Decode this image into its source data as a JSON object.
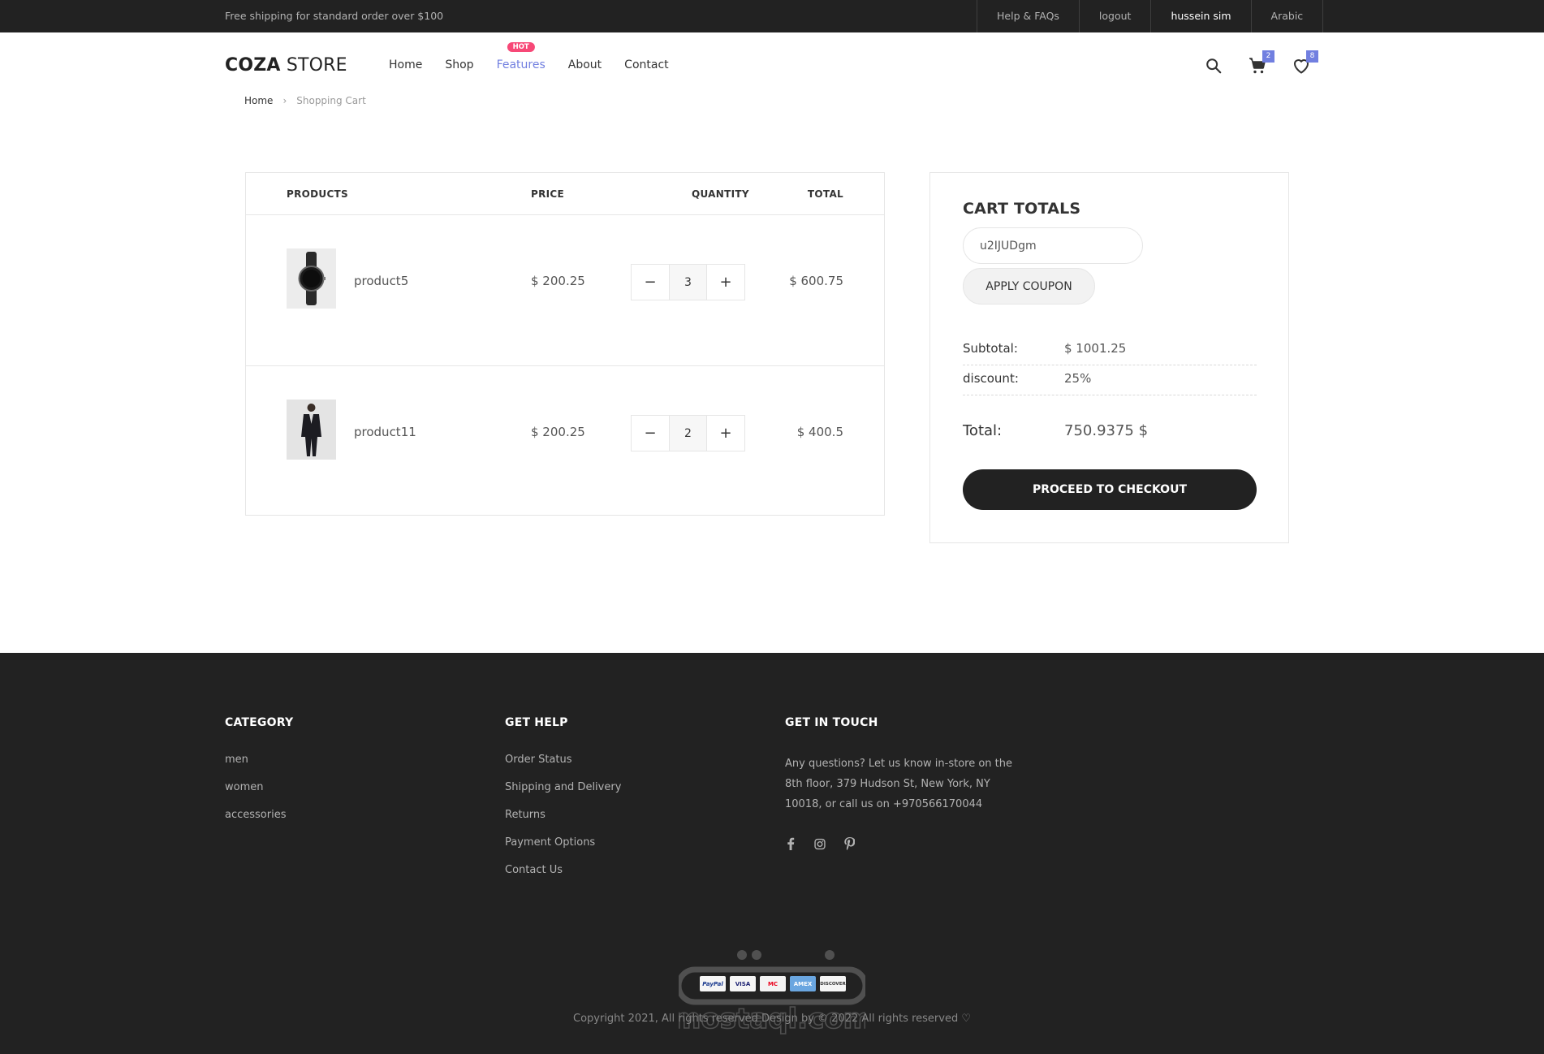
{
  "topbar": {
    "promo": "Free shipping for standard order over $100",
    "links": [
      "Help & FAQs",
      "logout",
      "hussein sim",
      "Arabic"
    ]
  },
  "header": {
    "logo_bold": "COZA",
    "logo_light": "STORE",
    "nav": [
      "Home",
      "Shop",
      "Features",
      "About",
      "Contact"
    ],
    "active_nav": "Features",
    "hot_badge": "HOT",
    "cart_count": "2",
    "wishlist_count": "8"
  },
  "breadcrumb": {
    "home": "Home",
    "current": "Shopping Cart"
  },
  "cart": {
    "headers": {
      "products": "PRODUCTS",
      "price": "PRICE",
      "quantity": "QUANTITY",
      "total": "TOTAL"
    },
    "items": [
      {
        "name": "product5",
        "price": "$ 200.25",
        "quantity": "3",
        "total": "$ 600.75",
        "image": "watch"
      },
      {
        "name": "product11",
        "price": "$ 200.25",
        "quantity": "2",
        "total": "$ 400.5",
        "image": "man-in-suit"
      }
    ],
    "minus": "−",
    "plus": "+"
  },
  "totals": {
    "title": "CART TOTALS",
    "coupon_value": "u2IJUDgm",
    "apply_label": "APPLY COUPON",
    "subtotal_label": "Subtotal:",
    "subtotal_value": "$ 1001.25",
    "discount_label": "discount:",
    "discount_value": "25%",
    "total_label": "Total:",
    "total_value": "750.9375 $",
    "checkout_label": "PROCEED TO CHECKOUT"
  },
  "footer": {
    "category": {
      "title": "CATEGORY",
      "links": [
        "men",
        "women",
        "accessories"
      ]
    },
    "help": {
      "title": "GET HELP",
      "links": [
        "Order Status",
        "Shipping and Delivery",
        "Returns",
        "Payment Options",
        "Contact Us"
      ]
    },
    "touch": {
      "title": "GET IN TOUCH",
      "text": "Any questions? Let us know in-store on the 8th floor, 379 Hudson St, New York, NY 10018, or call us on +970566170044",
      "social": [
        "facebook-icon",
        "instagram-icon",
        "pinterest-icon"
      ]
    },
    "payments": [
      "PayPal",
      "VISA",
      "MC",
      "AMEX",
      "DISCOVER"
    ],
    "copyright": "Copyright 2021, All rights reserved Design by © 2022 All rights reserved ♡",
    "watermark": "mostaql.com"
  },
  "colors": {
    "accent": "#717fe0",
    "hot": "#f74877",
    "dark": "#222222"
  }
}
